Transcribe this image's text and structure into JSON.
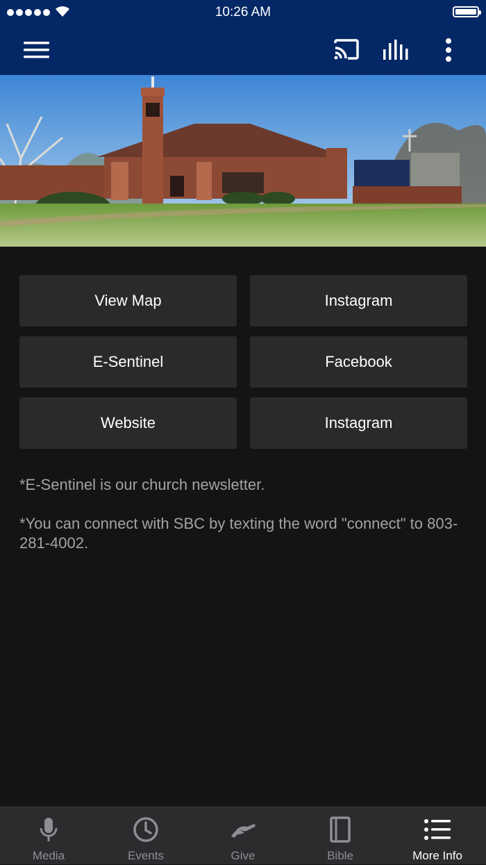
{
  "status_bar": {
    "time": "10:26 AM"
  },
  "nav_bar": {
    "menu_icon": "hamburger-menu-icon",
    "cast_icon": "cast-icon",
    "audio_icon": "audio-bars-icon",
    "more_icon": "vertical-ellipsis-icon",
    "background_color": "#042866"
  },
  "buttons": [
    {
      "label": "View Map"
    },
    {
      "label": "Instagram"
    },
    {
      "label": "E-Sentinel"
    },
    {
      "label": "Facebook"
    },
    {
      "label": "Website"
    },
    {
      "label": "Instagram"
    }
  ],
  "notes": {
    "newsletter": "*E-Sentinel is our church newsletter.",
    "connect": "*You can connect with SBC by texting the word \"connect\" to 803-281-4002."
  },
  "tab_bar": {
    "active_index": 4,
    "tabs": [
      {
        "label": "Media",
        "icon": "microphone-icon"
      },
      {
        "label": "Events",
        "icon": "clock-icon"
      },
      {
        "label": "Give",
        "icon": "giving-hand-icon"
      },
      {
        "label": "Bible",
        "icon": "book-icon"
      },
      {
        "label": "More Info",
        "icon": "list-icon"
      }
    ]
  }
}
